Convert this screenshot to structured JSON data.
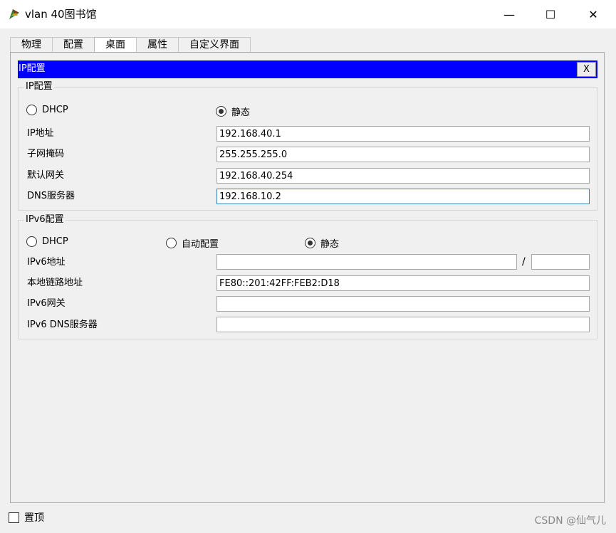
{
  "window": {
    "title": "vlan 40图书馆",
    "minimize_glyph": "—",
    "maximize_glyph": "☐",
    "close_glyph": "✕"
  },
  "tabs": [
    {
      "label": "物理",
      "active": false
    },
    {
      "label": "配置",
      "active": false
    },
    {
      "label": "桌面",
      "active": true
    },
    {
      "label": "属性",
      "active": false
    },
    {
      "label": "自定义界面",
      "active": false
    }
  ],
  "panel": {
    "title": "IP配置",
    "close_label": "X"
  },
  "ipv4": {
    "group_label": "IP配置",
    "dhcp_label": "DHCP",
    "static_label": "静态",
    "mode": "static",
    "ip_label": "IP地址",
    "ip_value": "192.168.40.1",
    "mask_label": "子网掩码",
    "mask_value": "255.255.255.0",
    "gateway_label": "默认网关",
    "gateway_value": "192.168.40.254",
    "dns_label": "DNS服务器",
    "dns_value": "192.168.10.2"
  },
  "ipv6": {
    "group_label": "IPv6配置",
    "dhcp_label": "DHCP",
    "auto_label": "自动配置",
    "static_label": "静态",
    "mode": "static",
    "addr_label": "IPv6地址",
    "addr_value": "",
    "prefix_sep": "/",
    "prefix_value": "",
    "linklocal_label": "本地链路地址",
    "linklocal_value": "FE80::201:42FF:FEB2:D18",
    "gateway_label": "IPv6网关",
    "gateway_value": "",
    "dns_label": "IPv6 DNS服务器",
    "dns_value": ""
  },
  "footer": {
    "topmost_label": "置顶",
    "topmost_checked": false,
    "watermark": "CSDN @仙气儿"
  },
  "colors": {
    "header_bar": "#0000ff",
    "background": "#f0f0f0"
  }
}
